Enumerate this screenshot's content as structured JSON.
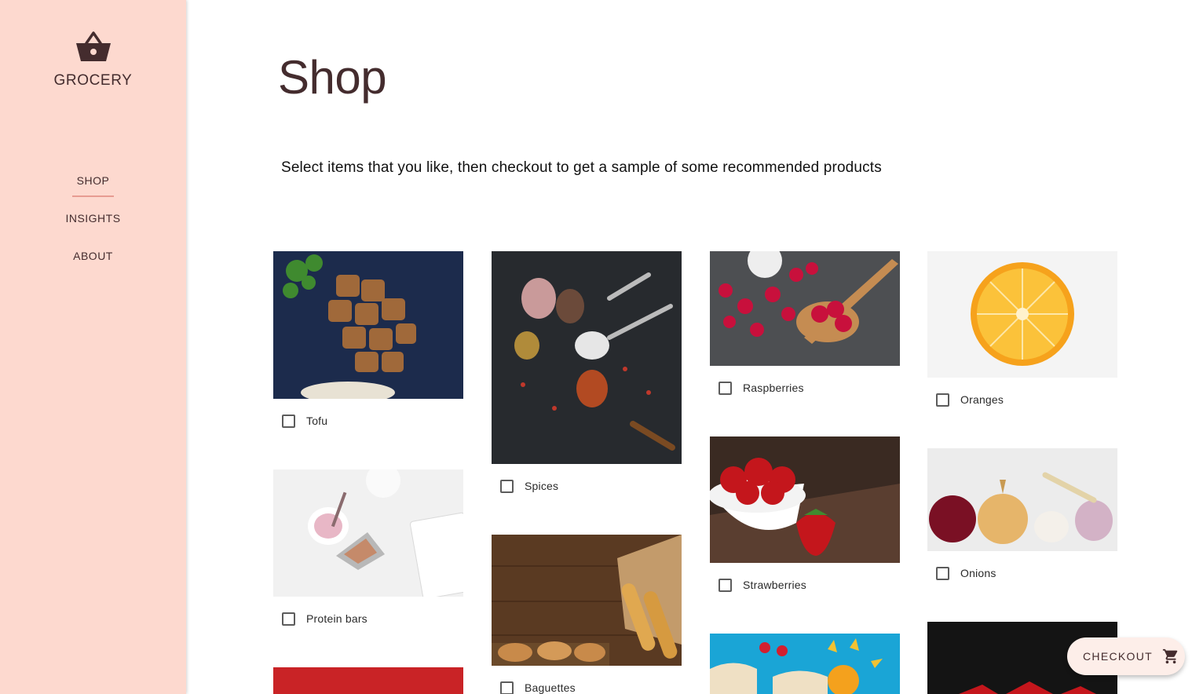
{
  "sidebar": {
    "brand": "GROCERY",
    "logo_icon": "basket-icon",
    "nav": [
      {
        "label": "SHOP",
        "active": true
      },
      {
        "label": "INSIGHTS",
        "active": false
      },
      {
        "label": "ABOUT",
        "active": false
      }
    ]
  },
  "main": {
    "title": "Shop",
    "subtitle": "Select items that you like, then checkout to get a sample of some recommended products"
  },
  "products": [
    {
      "name": "Tofu",
      "checked": false
    },
    {
      "name": "Protein bars",
      "checked": false
    },
    {
      "name": "Spices",
      "checked": false
    },
    {
      "name": "Baguettes",
      "checked": false
    },
    {
      "name": "Raspberries",
      "checked": false
    },
    {
      "name": "Strawberries",
      "checked": false
    },
    {
      "name": "Oranges",
      "checked": false
    },
    {
      "name": "Onions",
      "checked": false
    }
  ],
  "checkout": {
    "label": "CHECKOUT",
    "icon": "cart-icon"
  },
  "colors": {
    "sidebar_bg": "#fdd9cf",
    "text": "#442c2e",
    "accent": "#e79c92",
    "fab_bg": "#fdeee9"
  }
}
